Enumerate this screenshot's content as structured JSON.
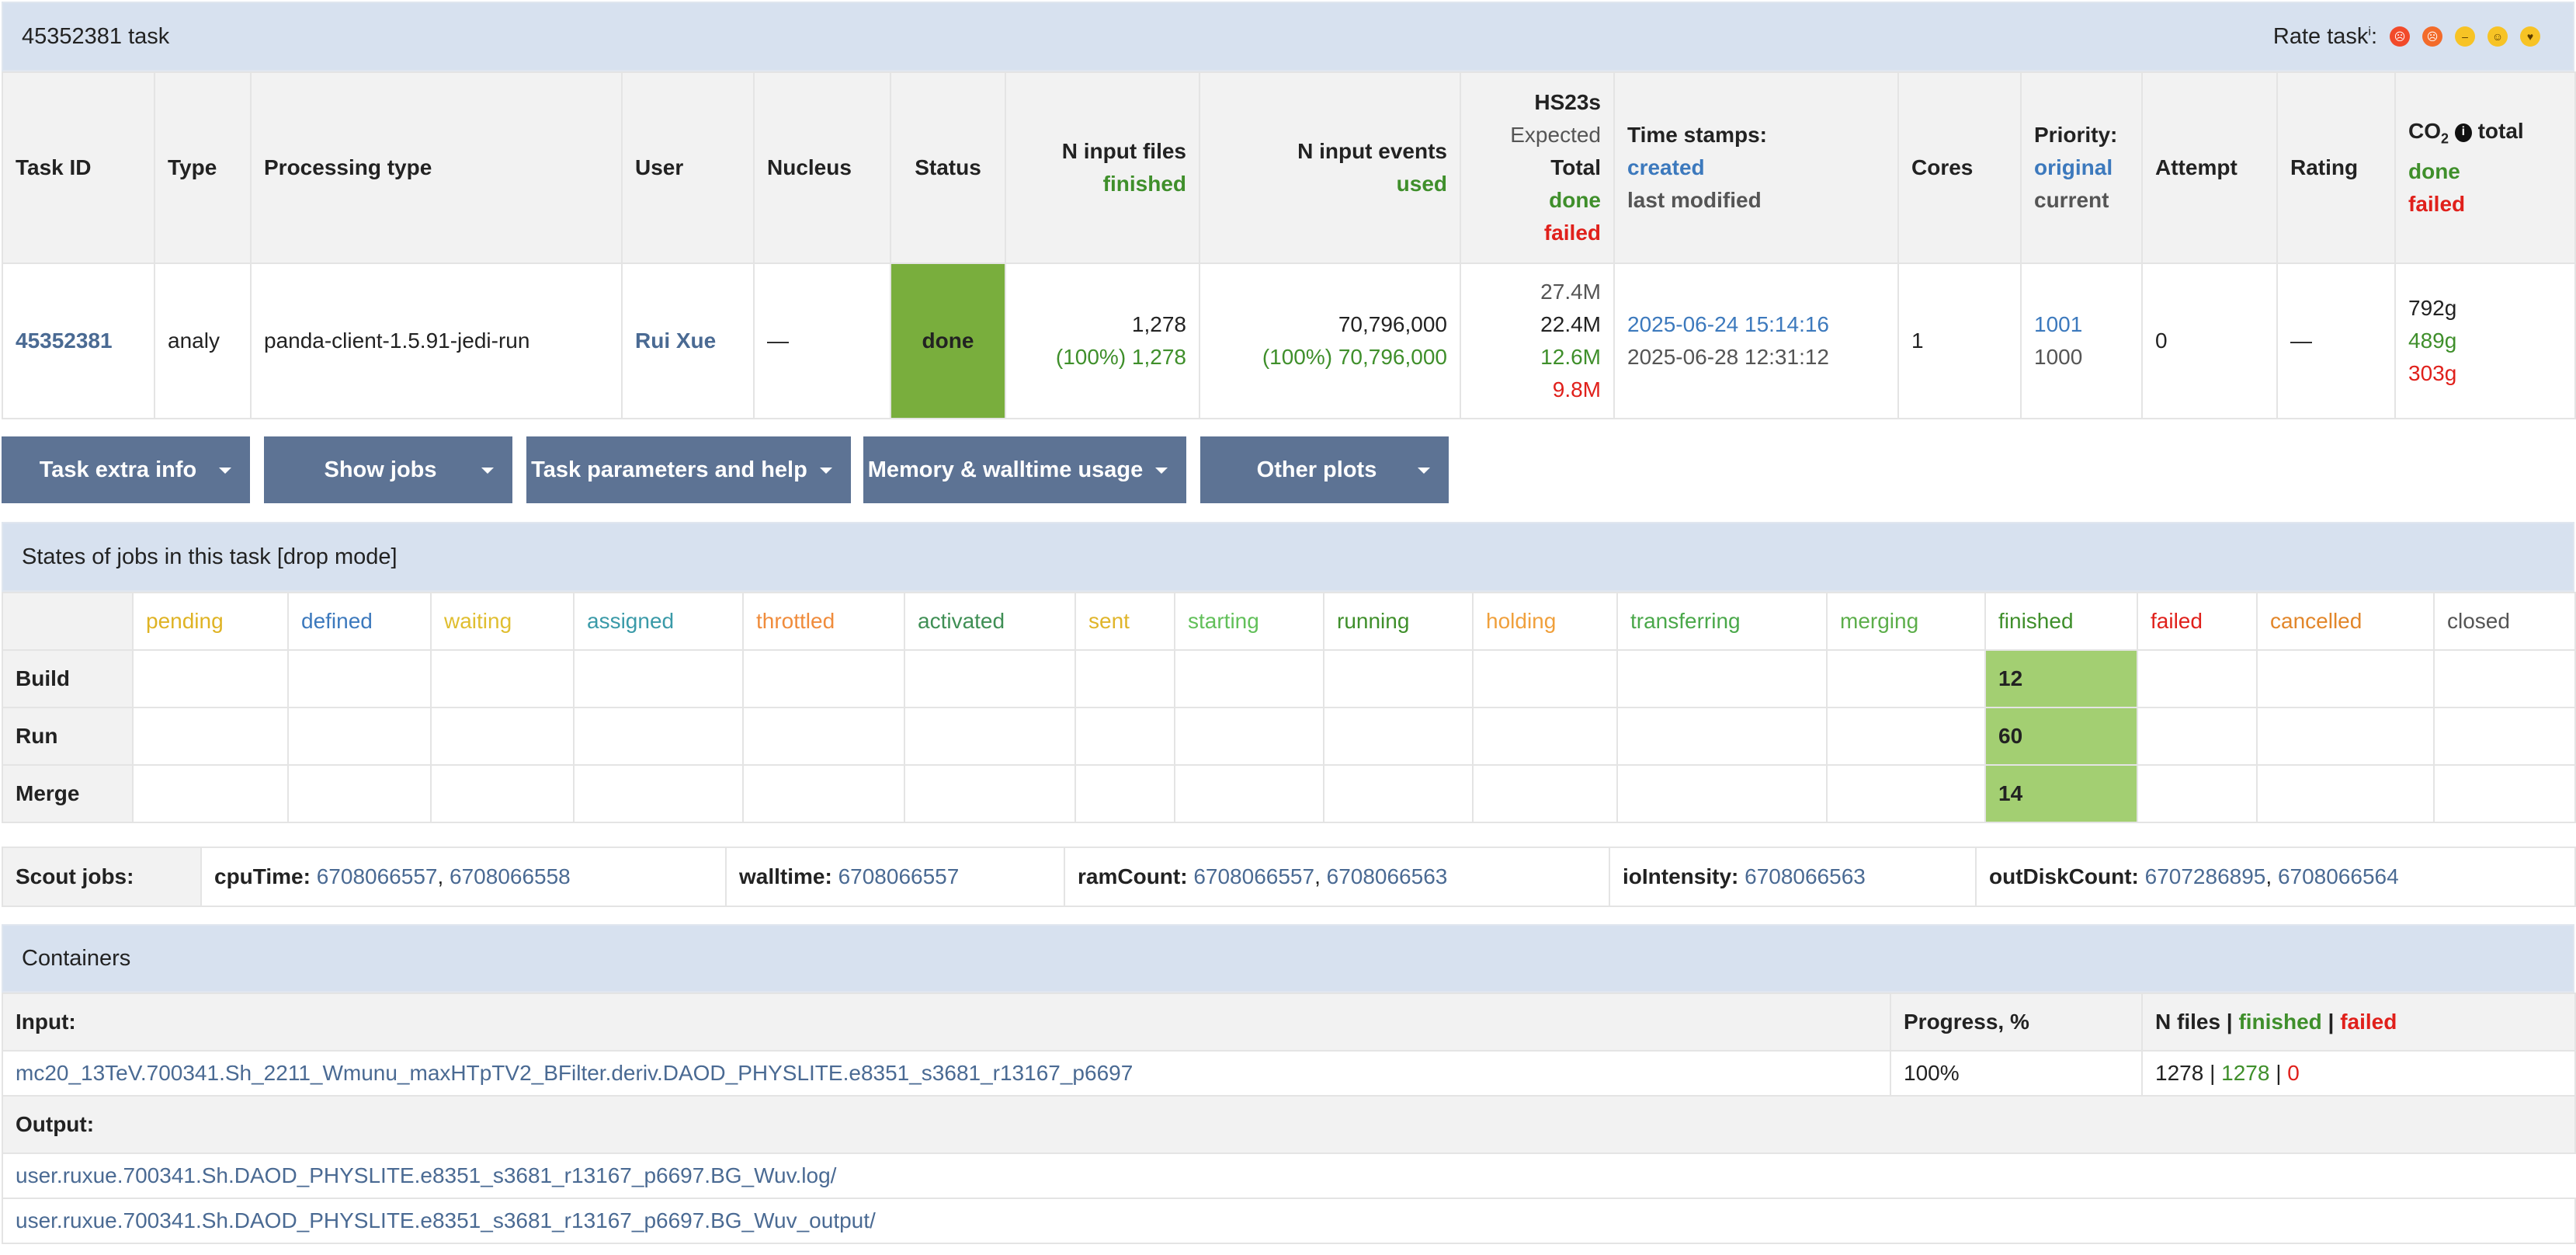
{
  "task_header": {
    "title": "45352381 task",
    "rate_label": "Rate task",
    "rate_info": "i",
    "rate_colon": ":"
  },
  "task_table": {
    "headers": {
      "task_id": "Task ID",
      "type": "Type",
      "processing_type": "Processing type",
      "user": "User",
      "nucleus": "Nucleus",
      "status": "Status",
      "n_input_files": "N input files",
      "n_input_files_sub": "finished",
      "n_input_events": "N input events",
      "n_input_events_sub": "used",
      "hs23s": "HS23s",
      "hs23s_expected": "Expected",
      "hs23s_total": "Total",
      "hs23s_done": "done",
      "hs23s_failed": "failed",
      "timestamps": "Time stamps:",
      "timestamps_created": "created",
      "timestamps_modified": "last modified",
      "cores": "Cores",
      "priority": "Priority:",
      "priority_original": "original",
      "priority_current": "current",
      "attempt": "Attempt",
      "rating": "Rating",
      "co2": "CO",
      "co2_sub": "2",
      "co2_total": "total",
      "co2_done": "done",
      "co2_failed": "failed"
    },
    "row": {
      "task_id": "45352381",
      "type": "analy",
      "processing_type": "panda-client-1.5.91-jedi-run",
      "user": "Rui Xue",
      "nucleus": "—",
      "status": "done",
      "n_input_files": "1,278",
      "n_input_files_finished": "(100%) 1,278",
      "n_input_events": "70,796,000",
      "n_input_events_used": "(100%) 70,796,000",
      "hs23s_expected": "27.4M",
      "hs23s_total": "22.4M",
      "hs23s_done": "12.6M",
      "hs23s_failed": "9.8M",
      "created": "2025-06-24 15:14:16",
      "modified": "2025-06-28 12:31:12",
      "cores": "1",
      "priority_original": "1001",
      "priority_current": "1000",
      "attempt": "0",
      "rating": "—",
      "co2_total": "792g",
      "co2_done": "489g",
      "co2_failed": "303g"
    }
  },
  "buttons": {
    "extra_info": "Task extra info",
    "show_jobs": "Show jobs",
    "params": "Task parameters and help",
    "memory": "Memory & walltime usage",
    "other_plots": "Other plots"
  },
  "states": {
    "title": "States of jobs in this task [drop mode]",
    "columns": [
      "pending",
      "defined",
      "waiting",
      "assigned",
      "throttled",
      "activated",
      "sent",
      "starting",
      "running",
      "holding",
      "transferring",
      "merging",
      "finished",
      "failed",
      "cancelled",
      "closed"
    ],
    "rows": [
      {
        "label": "Build",
        "finished": "12"
      },
      {
        "label": "Run",
        "finished": "60"
      },
      {
        "label": "Merge",
        "finished": "14"
      }
    ]
  },
  "scout": {
    "label": "Scout jobs:",
    "cpu_label": "cpuTime:",
    "cpu_ids": [
      "6708066557",
      "6708066558"
    ],
    "wall_label": "walltime:",
    "wall_ids": [
      "6708066557"
    ],
    "ram_label": "ramCount:",
    "ram_ids": [
      "6708066557",
      "6708066563"
    ],
    "io_label": "ioIntensity:",
    "io_ids": [
      "6708066563"
    ],
    "disk_label": "outDiskCount:",
    "disk_ids": [
      "6707286895",
      "6708066564"
    ],
    "sep": ", "
  },
  "containers": {
    "title": "Containers",
    "input_label": "Input:",
    "progress_label": "Progress, %",
    "nfiles_label": "N files",
    "nfiles_finished": "finished",
    "nfiles_failed": "failed",
    "pipe": " | ",
    "input_name": "mc20_13TeV.700341.Sh_2211_Wmunu_maxHTpTV2_BFilter.deriv.DAOD_PHYSLITE.e8351_s3681_r13167_p6697",
    "input_progress": "100%",
    "input_total": "1278",
    "input_finished": "1278",
    "input_failed": "0",
    "output_label": "Output:",
    "outputs": [
      "user.ruxue.700341.Sh.DAOD_PHYSLITE.e8351_s3681_r13167_p6697.BG_Wuv.log/",
      "user.ruxue.700341.Sh.DAOD_PHYSLITE.e8351_s3681_r13167_p6697.BG_Wuv_output/"
    ]
  }
}
